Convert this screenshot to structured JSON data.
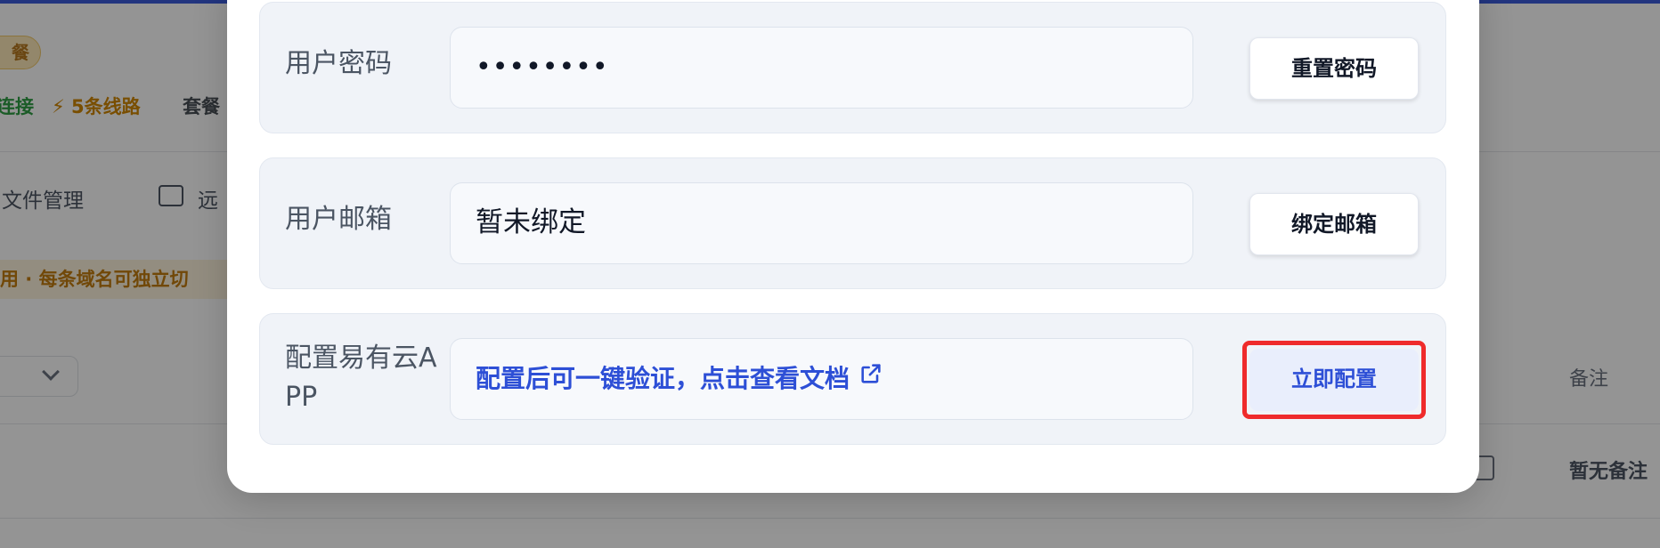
{
  "background": {
    "badge": "餐",
    "status_connect": "连接",
    "status_lines": "⚡ 5条线路",
    "status_plan": "套餐",
    "nav_files": "文件管理",
    "nav_remote": "远",
    "notice": "用 · 每条域名可独立切",
    "col_remark": "备注",
    "row_remark": "暂无备注"
  },
  "modal": {
    "password_row": {
      "label": "用户密码",
      "value": "••••••••",
      "button": "重置密码"
    },
    "email_row": {
      "label": "用户邮箱",
      "value": "暂未绑定",
      "button": "绑定邮箱"
    },
    "app_row": {
      "label": "配置易有云APP",
      "link_text": "配置后可一键验证，点击查看文档",
      "button": "立即配置"
    }
  },
  "colors": {
    "accent": "#2d4fd6",
    "highlight": "#ef2b2b"
  },
  "icons": [
    "external-link-icon",
    "monitor-icon",
    "chevron-down-icon",
    "copy-icon"
  ]
}
